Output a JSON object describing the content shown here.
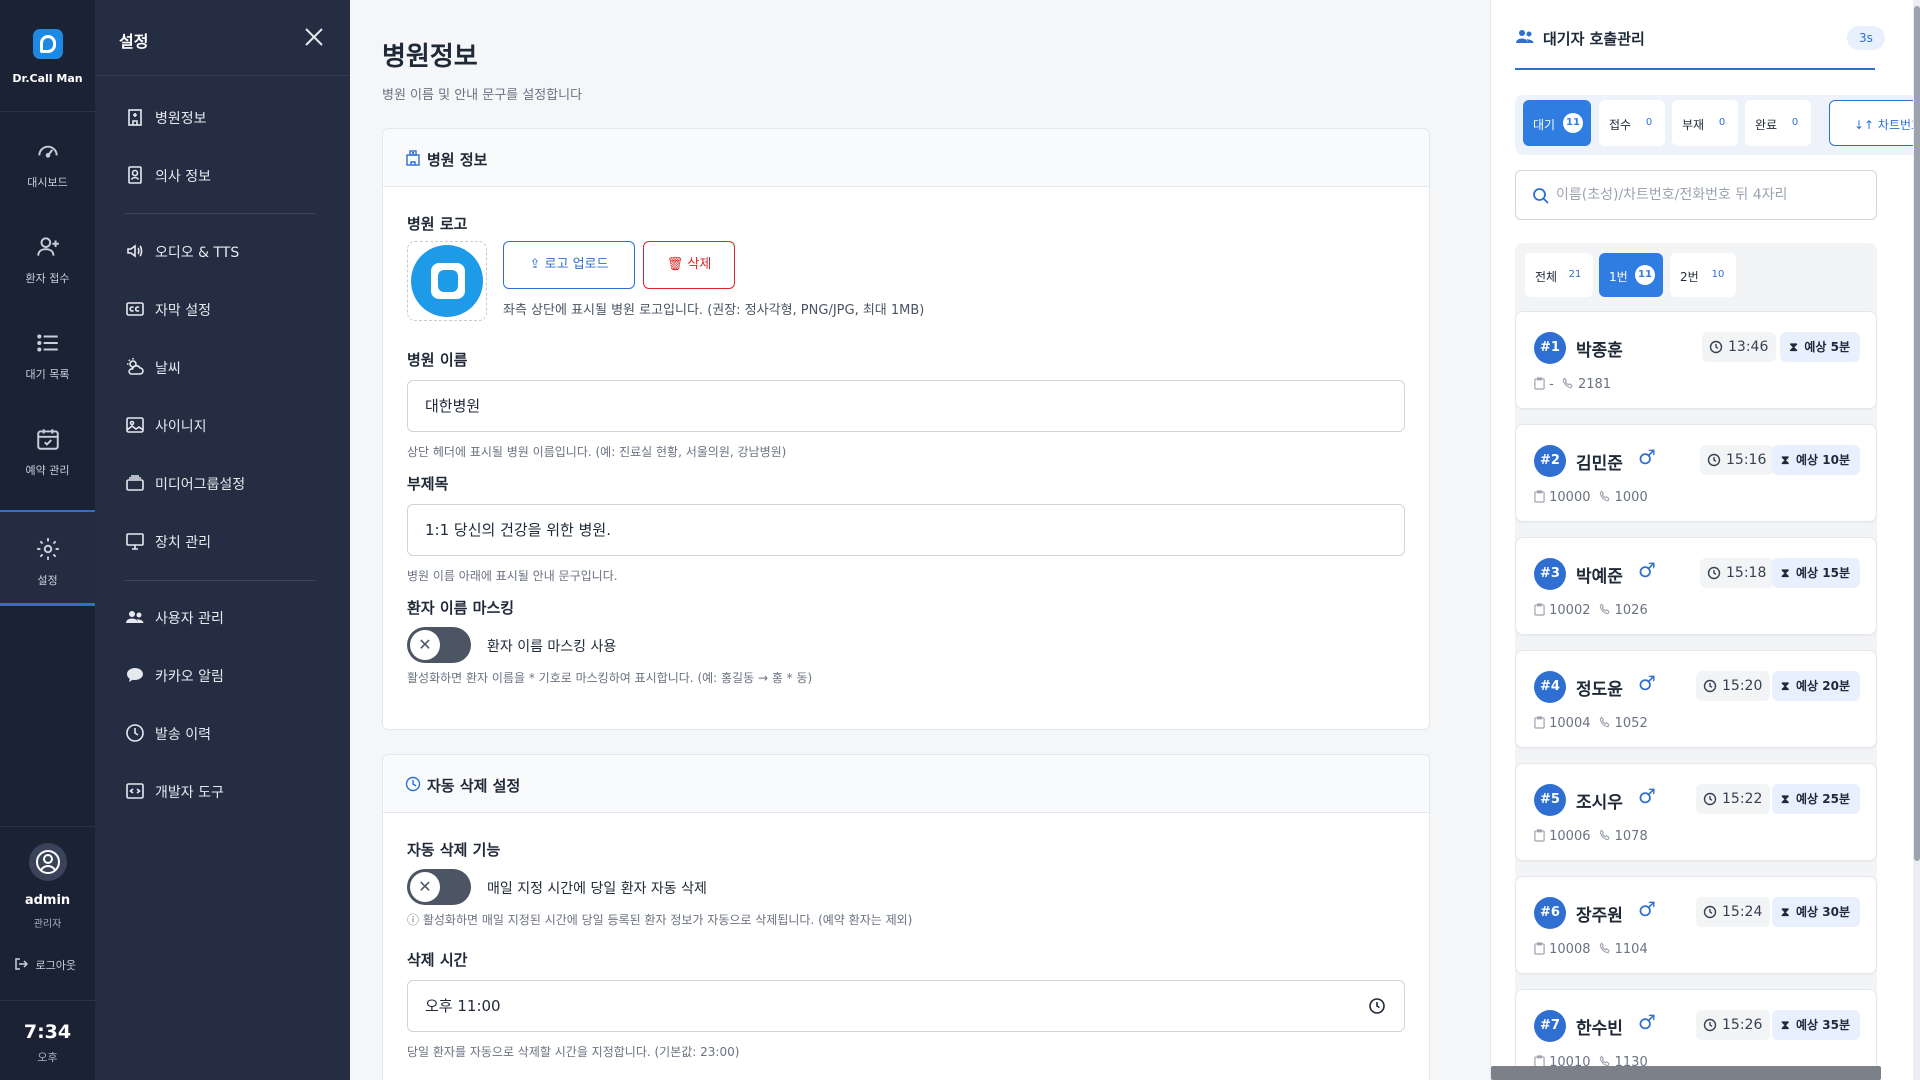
{
  "app": {
    "brand": "Dr.Call Man"
  },
  "rail": {
    "items": [
      {
        "label": "대시보드",
        "icon": "dashboard-icon"
      },
      {
        "label": "환자 접수",
        "icon": "add-user-icon"
      },
      {
        "label": "대기 목록",
        "icon": "list-icon"
      },
      {
        "label": "예약 관리",
        "icon": "calendar-check-icon"
      },
      {
        "label": "설정",
        "icon": "gear-icon",
        "active": true
      }
    ],
    "user": {
      "name": "admin",
      "role": "관리자",
      "logout": "로그아웃"
    },
    "clock": {
      "time": "7:34",
      "ampm": "오후"
    }
  },
  "settings": {
    "title": "설정",
    "items": [
      {
        "label": "병원정보",
        "icon": "hospital-icon"
      },
      {
        "label": "의사 정보",
        "icon": "id-badge-icon"
      },
      {
        "label": "오디오 & TTS",
        "icon": "speaker-icon"
      },
      {
        "label": "자막 설정",
        "icon": "cc-icon"
      },
      {
        "label": "날씨",
        "icon": "weather-icon"
      },
      {
        "label": "사이니지",
        "icon": "image-icon"
      },
      {
        "label": "미디어그룹설정",
        "icon": "layers-icon"
      },
      {
        "label": "장치 관리",
        "icon": "monitor-icon"
      },
      {
        "label": "사용자 관리",
        "icon": "users-icon"
      },
      {
        "label": "카카오 알림",
        "icon": "chat-bubble-icon"
      },
      {
        "label": "발송 이력",
        "icon": "clock-icon"
      },
      {
        "label": "개발자 도구",
        "icon": "code-icon"
      }
    ]
  },
  "main": {
    "title": "병원정보",
    "subtitle": "병원 이름 및 안내 문구를 설정합니다",
    "hospital_card": {
      "title": "병원 정보",
      "logo_label": "병원 로고",
      "upload_label": "로고 업로드",
      "delete_label": "삭제",
      "logo_hint": "좌측 상단에 표시될 병원 로고입니다. (권장: 정사각형, PNG/JPG, 최대 1MB)",
      "name_label": "병원 이름",
      "name_value": "대한병원",
      "name_hint": "상단 헤더에 표시될 병원 이름입니다. (예: 진료실 현황, 서울의원, 강남병원)",
      "subtitle_label": "부제목",
      "subtitle_value": "1:1 당신의 건강을 위한 병원.",
      "subtitle_hint": "병원 이름 아래에 표시될 안내 문구입니다.",
      "masking_label": "환자 이름 마스킹",
      "masking_toggle_label": "환자 이름 마스킹 사용",
      "masking_hint": "활성화하면 환자 이름을 * 기호로 마스킹하여 표시합니다. (예: 홍길동 → 홍 * 동)"
    },
    "delete_card": {
      "title": "자동 삭제 설정",
      "feature_label": "자동 삭제 기능",
      "toggle_label": "매일 지정 시간에 당일 환자 자동 삭제",
      "toggle_hint": "활성화하면 매일 지정된 시간에 당일 등록된 환자 정보가 자동으로 삭제됩니다. (예약 환자는 제외)",
      "time_label": "삭제 시간",
      "time_value": "오후 11:00",
      "time_hint": "당일 환자를 자동으로 삭제할 시간을 지정합니다. (기본값: 23:00)"
    }
  },
  "queue": {
    "title": "대기자 호출관리",
    "refresh": "3s",
    "status_tabs": [
      {
        "label": "대기",
        "count": "11",
        "active": true
      },
      {
        "label": "접수",
        "count": "0"
      },
      {
        "label": "부재",
        "count": "0"
      },
      {
        "label": "완료",
        "count": "0"
      }
    ],
    "sort_label": "↓↑ 차트번호",
    "search_placeholder": "이름(초성)/차트번호/전화번호 뒤 4자리",
    "room_tabs": [
      {
        "label": "전체",
        "count": "21"
      },
      {
        "label": "1번",
        "count": "11",
        "active": true
      },
      {
        "label": "2번",
        "count": "10"
      }
    ],
    "patients": [
      {
        "num": "#1",
        "name": "박종훈",
        "gender": "",
        "time": "13:46",
        "wait": "예상 5분",
        "chart": "-",
        "phone": "2181"
      },
      {
        "num": "#2",
        "name": "김민준",
        "gender": "♂",
        "time": "15:16",
        "wait": "예상 10분",
        "chart": "10000",
        "phone": "1000"
      },
      {
        "num": "#3",
        "name": "박예준",
        "gender": "♂",
        "time": "15:18",
        "wait": "예상 15분",
        "chart": "10002",
        "phone": "1026"
      },
      {
        "num": "#4",
        "name": "정도윤",
        "gender": "♂",
        "time": "15:20",
        "wait": "예상 20분",
        "chart": "10004",
        "phone": "1052"
      },
      {
        "num": "#5",
        "name": "조시우",
        "gender": "♂",
        "time": "15:22",
        "wait": "예상 25분",
        "chart": "10006",
        "phone": "1078"
      },
      {
        "num": "#6",
        "name": "장주원",
        "gender": "♂",
        "time": "15:24",
        "wait": "예상 30분",
        "chart": "10008",
        "phone": "1104"
      },
      {
        "num": "#7",
        "name": "한수빈",
        "gender": "♂",
        "time": "15:26",
        "wait": "예상 35분",
        "chart": "10010",
        "phone": "1130"
      }
    ]
  },
  "colors": {
    "accent": "#2f6fd1",
    "rail_bg": "#1b2233",
    "sidebar_bg": "#252d42",
    "danger": "#dc2626"
  }
}
